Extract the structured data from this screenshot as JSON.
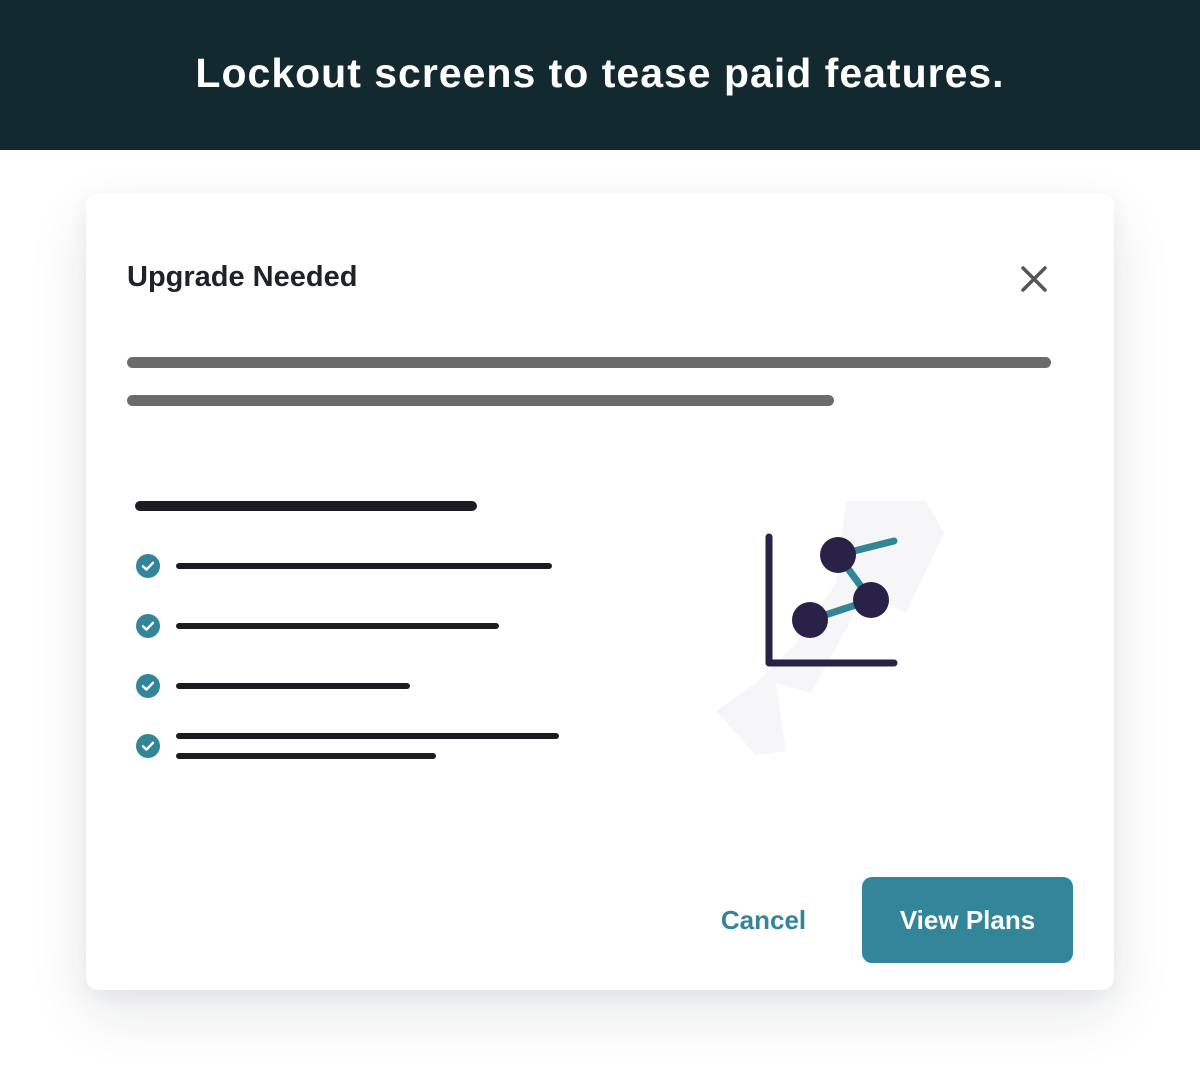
{
  "banner": {
    "title": "Lockout screens to tease paid features."
  },
  "modal": {
    "title": "Upgrade Needed",
    "close_icon": "close-icon",
    "description_placeholder_lines": 2,
    "feature_list": {
      "heading_placeholder": true,
      "items": [
        {
          "icon": "check-circle-icon"
        },
        {
          "icon": "check-circle-icon"
        },
        {
          "icon": "check-circle-icon"
        },
        {
          "icon": "check-circle-icon"
        }
      ]
    },
    "illustration_icon": "analytics-chart-icon",
    "cancel_label": "Cancel",
    "primary_label": "View Plans"
  },
  "colors": {
    "banner_bg": "#12292f",
    "accent": "#33859a",
    "chart_dark": "#2a2146",
    "text_dark": "#1f2228",
    "placeholder_gray": "#6b6b6b"
  }
}
